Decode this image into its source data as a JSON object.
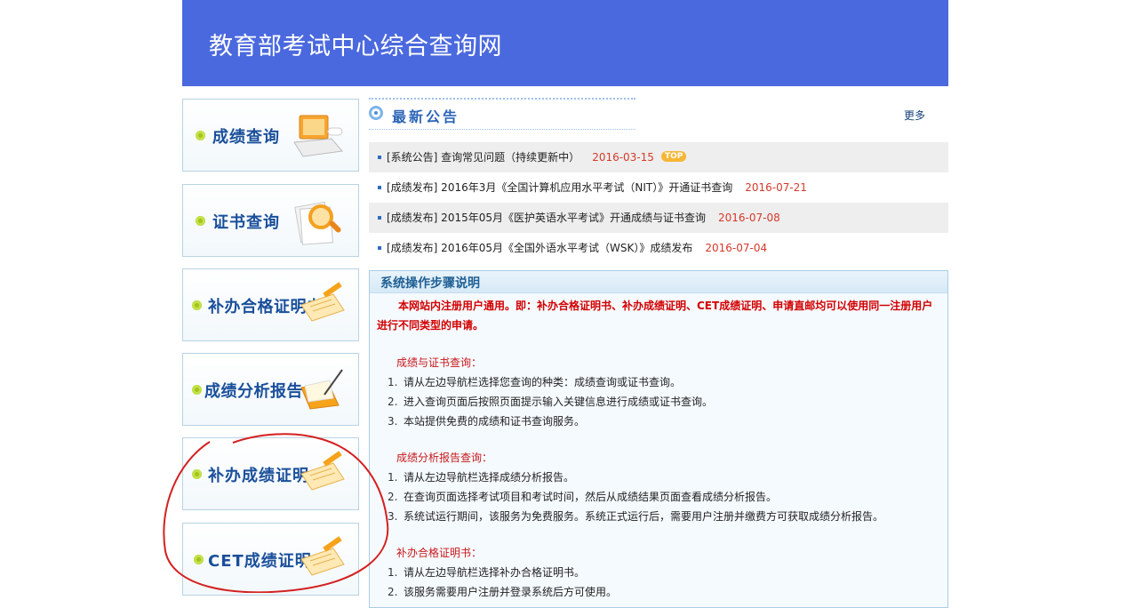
{
  "header": {
    "title": "教育部考试中心综合查询网"
  },
  "sidebar": {
    "items": [
      {
        "label": "成绩查询"
      },
      {
        "label": "证书查询"
      },
      {
        "label": "补办合格证明书"
      },
      {
        "label": "成绩分析报告"
      },
      {
        "label": "补办成绩证明"
      },
      {
        "label": "CET成绩证明"
      }
    ]
  },
  "news": {
    "heading": "最新公告",
    "more": "更多",
    "top_badge": "TOP",
    "items": [
      {
        "text": "[系统公告] 查询常见问题（持续更新中）",
        "date": "2016-03-15"
      },
      {
        "text": "[成绩发布] 2016年3月《全国计算机应用水平考试（NIT）》开通证书查询",
        "date": "2016-07-21"
      },
      {
        "text": "[成绩发布] 2015年05月《医护英语水平考试》开通成绩与证书查询",
        "date": "2016-07-08"
      },
      {
        "text": "[成绩发布] 2016年05月《全国外语水平考试（WSK）》成绩发布",
        "date": "2016-07-04"
      }
    ]
  },
  "steps": {
    "title": "系统操作步骤说明",
    "intro": "本网站内注册用户通用。即：补办合格证明书、补办成绩证明、CET成绩证明、申请直邮均可以使用同一注册用户进行不同类型的申请。",
    "sections": [
      {
        "title": "成绩与证书查询：",
        "items": [
          {
            "num": "1.",
            "text": "请从左边导航栏选择您查询的种类：成绩查询或证书查询。"
          },
          {
            "num": "2.",
            "text": "进入查询页面后按照页面提示输入关键信息进行成绩或证书查询。"
          },
          {
            "num": "3.",
            "text": "本站提供免费的成绩和证书查询服务。"
          }
        ]
      },
      {
        "title": "成绩分析报告查询：",
        "items": [
          {
            "num": "1.",
            "text": "请从左边导航栏选择成绩分析报告。"
          },
          {
            "num": "2.",
            "text": "在查询页面选择考试项目和考试时间，然后从成绩结果页面查看成绩分析报告。"
          },
          {
            "num": "3.",
            "text": "系统试运行期间，该服务为免费服务。系统正式运行后，需要用户注册并缴费方可获取成绩分析报告。"
          }
        ]
      },
      {
        "title": "补办合格证明书：",
        "items": [
          {
            "num": "1.",
            "text": "请从左边导航栏选择补办合格证明书。"
          },
          {
            "num": "2.",
            "text": "该服务需要用户注册并登录系统后方可使用。"
          }
        ]
      }
    ]
  },
  "colors": {
    "header_bg": "#4b69de",
    "date_red": "#d53a2a",
    "annotation_red": "#d42020"
  }
}
